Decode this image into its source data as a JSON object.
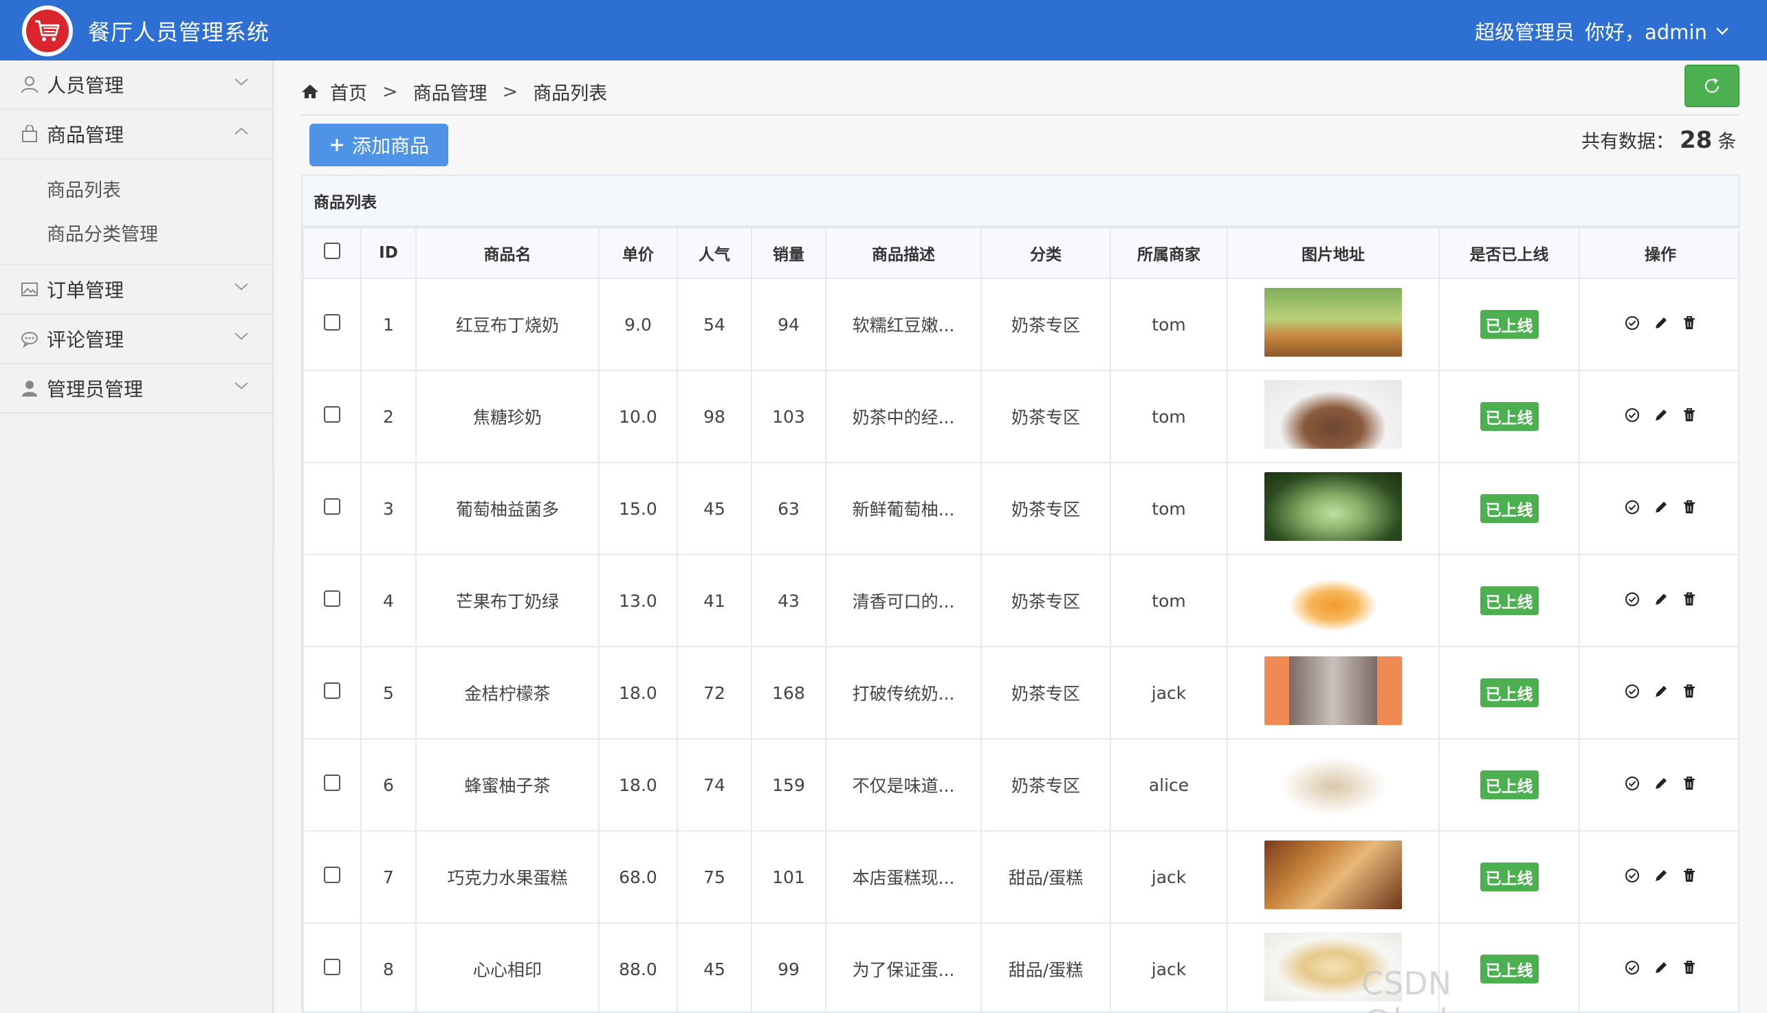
{
  "header": {
    "app_title": "餐厅人员管理系统",
    "role": "超级管理员",
    "greeting": "你好，admin"
  },
  "sidebar": {
    "items": [
      {
        "label": "人员管理",
        "icon": "user-icon",
        "expanded": false
      },
      {
        "label": "商品管理",
        "icon": "bag-icon",
        "expanded": true,
        "children": [
          "商品列表",
          "商品分类管理"
        ]
      },
      {
        "label": "订单管理",
        "icon": "picture-icon",
        "expanded": false
      },
      {
        "label": "评论管理",
        "icon": "comment-icon",
        "expanded": false
      },
      {
        "label": "管理员管理",
        "icon": "person-icon",
        "expanded": false
      }
    ]
  },
  "breadcrumb": [
    "首页",
    "商品管理",
    "商品列表"
  ],
  "toolbar": {
    "add_label": "添加商品",
    "total_prefix": "共有数据：",
    "total_count": "28",
    "total_suffix": "条"
  },
  "panel_title": "商品列表",
  "table": {
    "columns": [
      "ID",
      "商品名",
      "单价",
      "人气",
      "销量",
      "商品描述",
      "分类",
      "所属商家",
      "图片地址",
      "是否已上线",
      "操作"
    ],
    "rows": [
      {
        "id": "1",
        "name": "红豆布丁烧奶",
        "price": "9.0",
        "popularity": "54",
        "sales": "94",
        "desc": "软糯红豆嫩...",
        "category": "奶茶专区",
        "merchant": "tom",
        "status": "已上线"
      },
      {
        "id": "2",
        "name": "焦糖珍奶",
        "price": "10.0",
        "popularity": "98",
        "sales": "103",
        "desc": "奶茶中的经...",
        "category": "奶茶专区",
        "merchant": "tom",
        "status": "已上线"
      },
      {
        "id": "3",
        "name": "葡萄柚益菌多",
        "price": "15.0",
        "popularity": "45",
        "sales": "63",
        "desc": "新鲜葡萄柚...",
        "category": "奶茶专区",
        "merchant": "tom",
        "status": "已上线"
      },
      {
        "id": "4",
        "name": "芒果布丁奶绿",
        "price": "13.0",
        "popularity": "41",
        "sales": "43",
        "desc": "清香可口的...",
        "category": "奶茶专区",
        "merchant": "tom",
        "status": "已上线"
      },
      {
        "id": "5",
        "name": "金桔柠檬茶",
        "price": "18.0",
        "popularity": "72",
        "sales": "168",
        "desc": "打破传统奶...",
        "category": "奶茶专区",
        "merchant": "jack",
        "status": "已上线"
      },
      {
        "id": "6",
        "name": "蜂蜜柚子茶",
        "price": "18.0",
        "popularity": "74",
        "sales": "159",
        "desc": "不仅是味道...",
        "category": "奶茶专区",
        "merchant": "alice",
        "status": "已上线"
      },
      {
        "id": "7",
        "name": "巧克力水果蛋糕",
        "price": "68.0",
        "popularity": "75",
        "sales": "101",
        "desc": "本店蛋糕现...",
        "category": "甜品/蛋糕",
        "merchant": "jack",
        "status": "已上线"
      },
      {
        "id": "8",
        "name": "心心相印",
        "price": "88.0",
        "popularity": "45",
        "sales": "99",
        "desc": "为了保证蛋...",
        "category": "甜品/蛋糕",
        "merchant": "jack",
        "status": "已上线"
      }
    ]
  },
  "watermark": "CSDN @lucky_programmer",
  "colors": {
    "header_bg": "#2d6fd2",
    "primary_button": "#4f93e6",
    "success": "#4caf50",
    "logo_red": "#d9252b"
  }
}
